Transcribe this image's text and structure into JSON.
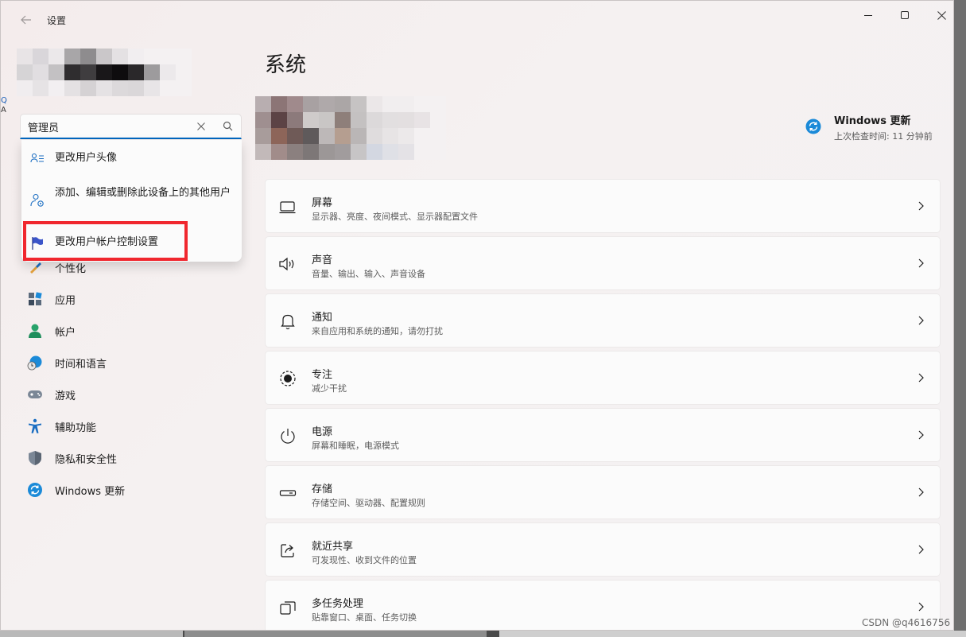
{
  "app": {
    "title": "设置"
  },
  "search": {
    "value": "管理员"
  },
  "suggestions": [
    {
      "label": "更改用户头像",
      "icon": "user-list-icon"
    },
    {
      "label": "添加、编辑或删除此设备上的其他用户",
      "icon": "user-settings-icon"
    },
    {
      "label": "更改用户帐户控制设置",
      "icon": "flag-icon"
    }
  ],
  "sidebar": {
    "items": [
      {
        "label": "个性化",
        "icon": "brush-icon"
      },
      {
        "label": "应用",
        "icon": "apps-icon"
      },
      {
        "label": "帐户",
        "icon": "account-icon"
      },
      {
        "label": "时间和语言",
        "icon": "globe-clock-icon"
      },
      {
        "label": "游戏",
        "icon": "gamepad-icon"
      },
      {
        "label": "辅助功能",
        "icon": "accessibility-icon"
      },
      {
        "label": "隐私和安全性",
        "icon": "shield-icon"
      },
      {
        "label": "Windows 更新",
        "icon": "sync-icon"
      }
    ]
  },
  "main": {
    "title": "系统",
    "windows_update": {
      "title": "Windows 更新",
      "subtitle": "上次检查时间: 11 分钟前"
    },
    "cards": [
      {
        "title": "屏幕",
        "subtitle": "显示器、亮度、夜间模式、显示器配置文件",
        "icon": "monitor-icon"
      },
      {
        "title": "声音",
        "subtitle": "音量、输出、输入、声音设备",
        "icon": "speaker-icon"
      },
      {
        "title": "通知",
        "subtitle": "来自应用和系统的通知，请勿打扰",
        "icon": "bell-icon"
      },
      {
        "title": "专注",
        "subtitle": "减少干扰",
        "icon": "focus-icon"
      },
      {
        "title": "电源",
        "subtitle": "屏幕和睡眠，电源模式",
        "icon": "power-icon"
      },
      {
        "title": "存储",
        "subtitle": "存储空间、驱动器、配置规则",
        "icon": "storage-icon"
      },
      {
        "title": "就近共享",
        "subtitle": "可发现性、收到文件的位置",
        "icon": "share-icon"
      },
      {
        "title": "多任务处理",
        "subtitle": "贴靠窗口、桌面、任务切换",
        "icon": "multitask-icon"
      }
    ]
  },
  "watermark": "CSDN @q4616756",
  "colors": {
    "accent": "#0067c0",
    "highlight": "#f0272e"
  }
}
